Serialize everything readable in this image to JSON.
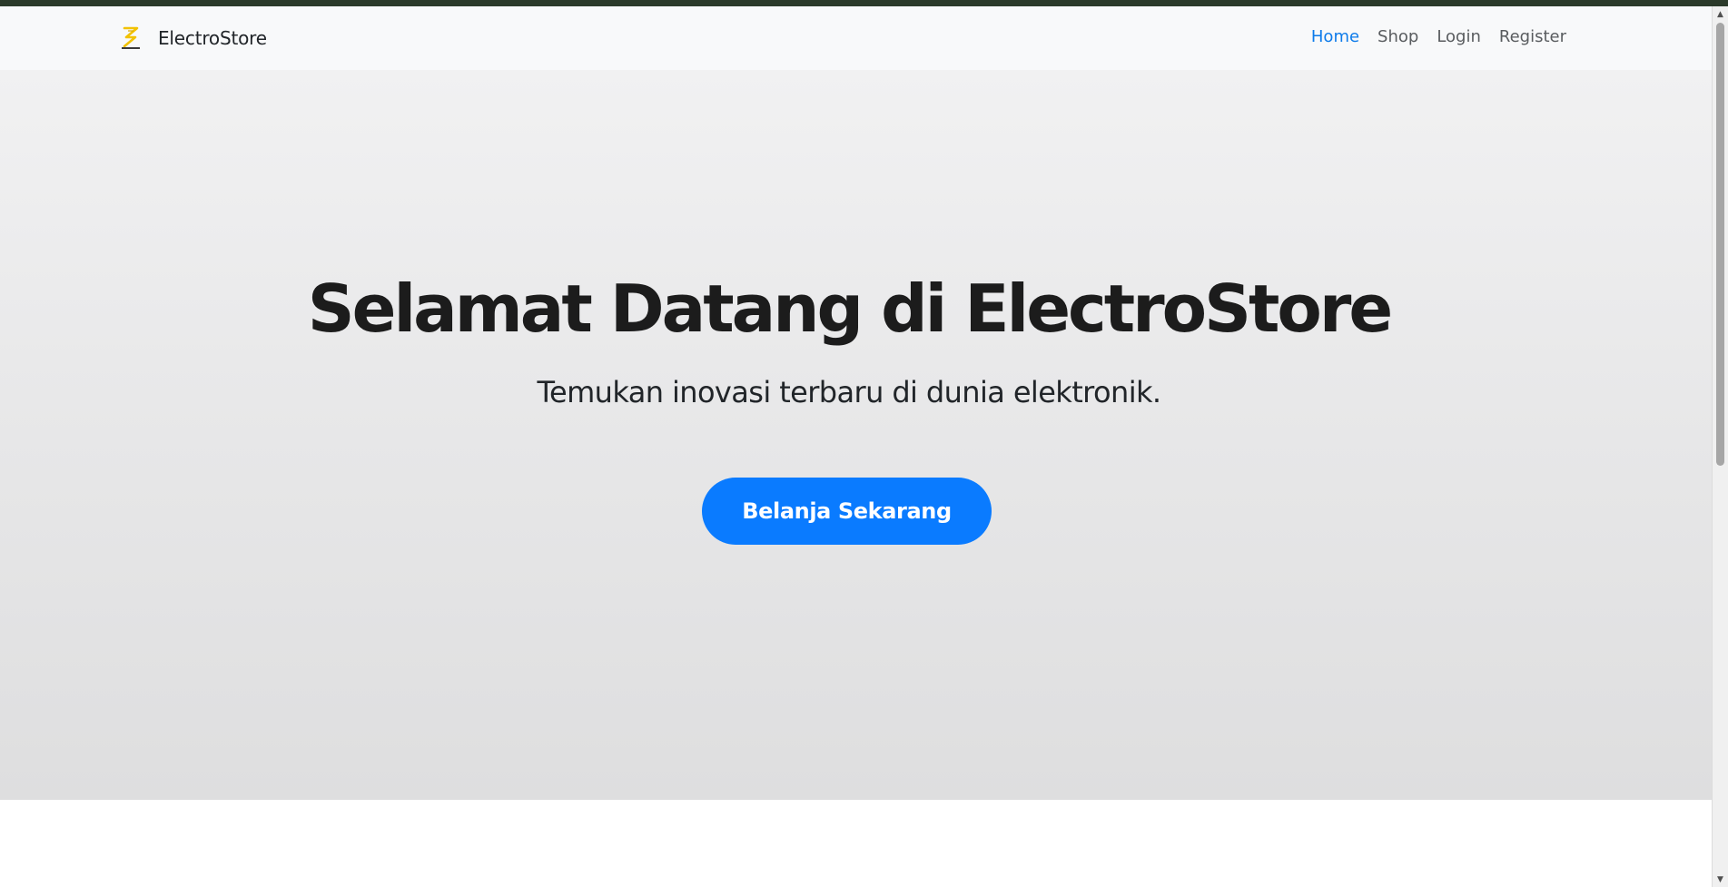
{
  "header": {
    "brand_name": "ElectroStore",
    "brand_logo_icon": "zigzag-logo-icon",
    "nav": [
      {
        "label": "Home",
        "active": true
      },
      {
        "label": "Shop",
        "active": false
      },
      {
        "label": "Login",
        "active": false
      },
      {
        "label": "Register",
        "active": false
      }
    ]
  },
  "hero": {
    "title": "Selamat Datang di ElectroStore",
    "subtitle": "Temukan inovasi terbaru di dunia elektronik.",
    "cta_label": "Belanja Sekarang"
  },
  "colors": {
    "accent": "#0a7bff",
    "nav_active": "#0d7bea",
    "text_dark": "#1c1c1c",
    "logo_yellow": "#f2c200"
  }
}
